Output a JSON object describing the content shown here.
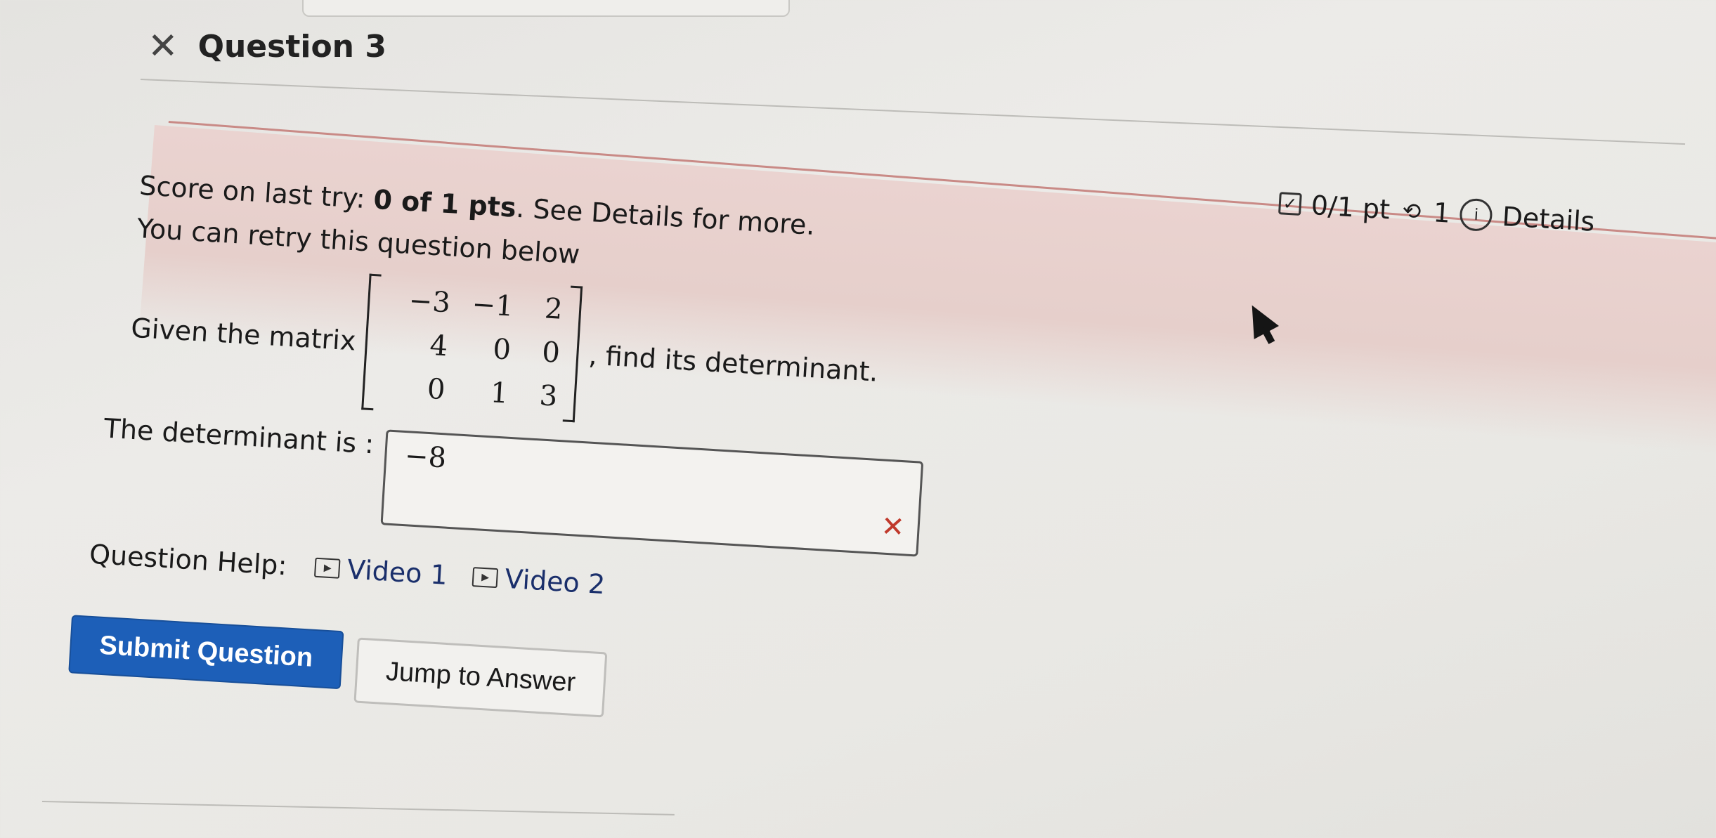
{
  "question": {
    "title": "Question 3",
    "close_icon": "close-icon"
  },
  "feedback": {
    "score_prefix": "Score on last try: ",
    "score_value": "0 of 1 pts",
    "score_suffix": ". See Details for more.",
    "retry_text": "You can retry this question below"
  },
  "meta": {
    "points": "0/1 pt",
    "retries": "1",
    "details_label": "Details",
    "checkbox_icon": "checkbox-icon",
    "retry_icon": "retry-icon",
    "info_icon": "info-icon"
  },
  "problem": {
    "prefix": "Given the matrix",
    "suffix": ", find its determinant.",
    "matrix": [
      [
        "−3",
        "−1",
        "2"
      ],
      [
        "4",
        "0",
        "0"
      ],
      [
        "0",
        "1",
        "3"
      ]
    ]
  },
  "answer": {
    "label": "The determinant is :",
    "value": "−8",
    "status": "incorrect",
    "status_color": "#c0392b"
  },
  "help": {
    "label": "Question Help:",
    "videos": [
      "Video 1",
      "Video 2"
    ]
  },
  "buttons": {
    "submit": "Submit Question",
    "jump": "Jump to Answer"
  },
  "colors": {
    "submit_bg": "#1d5fb8",
    "feedback_bg": "#e6cfcb"
  }
}
